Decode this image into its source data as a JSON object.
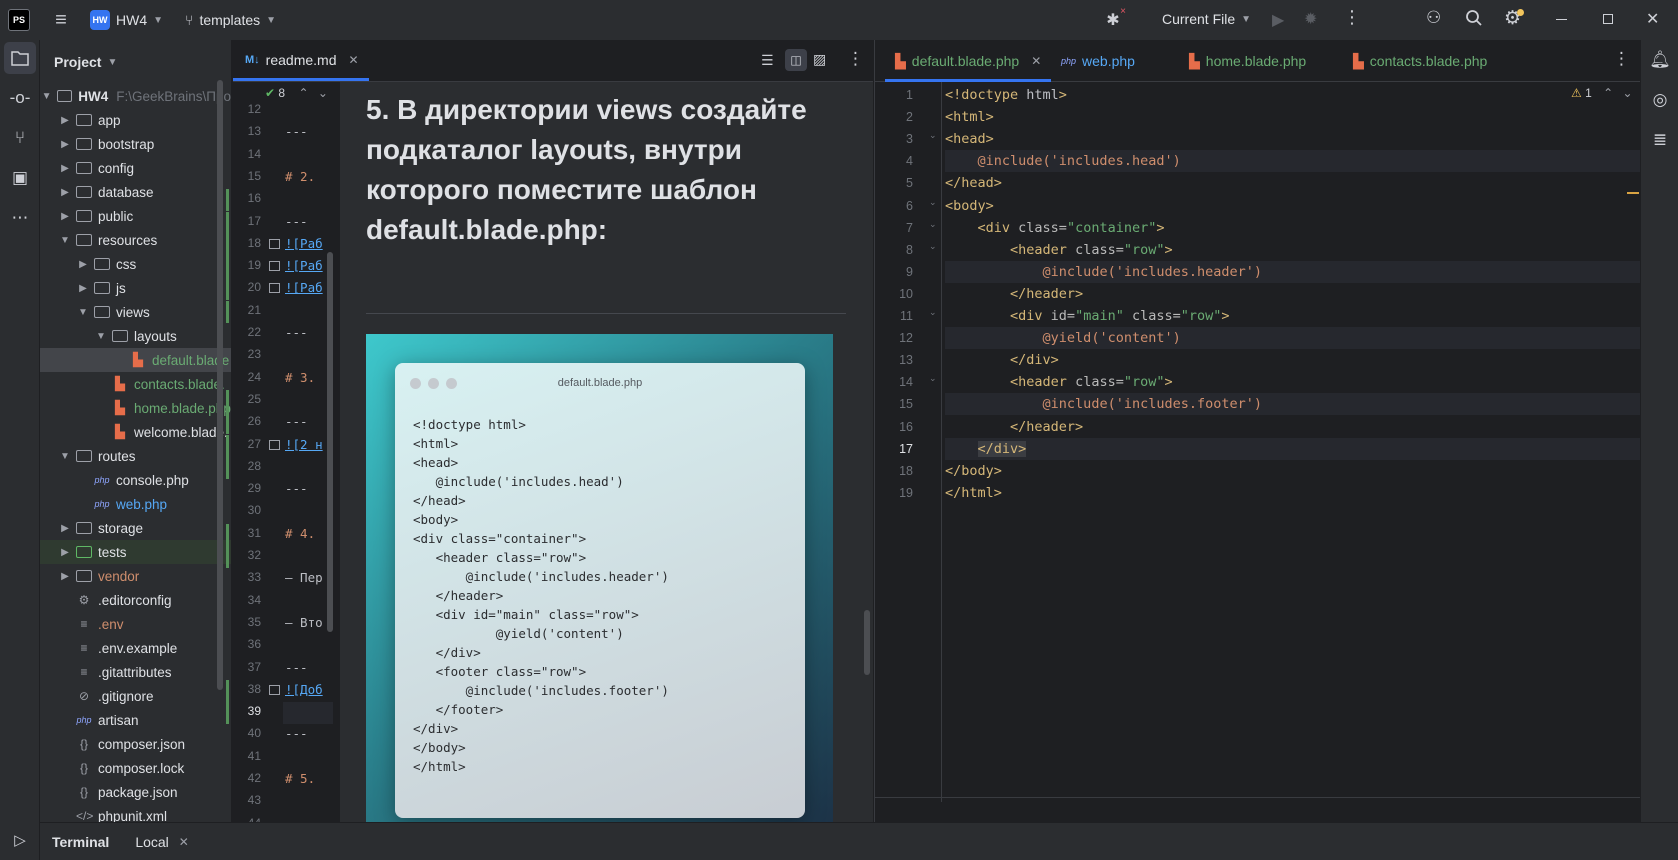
{
  "titlebar": {
    "app_logo": "PS",
    "project_badge": "HW",
    "project_name": "HW4",
    "branch": "templates",
    "run_config": "Current File"
  },
  "project_panel": {
    "title": "Project",
    "root_name": "HW4",
    "root_path": "F:\\GeekBrains\\Про",
    "tree": [
      {
        "label": "app",
        "type": "folder",
        "depth": 1,
        "open": false
      },
      {
        "label": "bootstrap",
        "type": "folder",
        "depth": 1,
        "open": false
      },
      {
        "label": "config",
        "type": "folder",
        "depth": 1,
        "open": false
      },
      {
        "label": "database",
        "type": "folder",
        "depth": 1,
        "open": false
      },
      {
        "label": "public",
        "type": "folder",
        "depth": 1,
        "open": false
      },
      {
        "label": "resources",
        "type": "folder",
        "depth": 1,
        "open": true
      },
      {
        "label": "css",
        "type": "folder",
        "depth": 2,
        "open": false
      },
      {
        "label": "js",
        "type": "folder",
        "depth": 2,
        "open": false
      },
      {
        "label": "views",
        "type": "folder",
        "depth": 2,
        "open": true
      },
      {
        "label": "layouts",
        "type": "folder",
        "depth": 3,
        "open": true
      },
      {
        "label": "default.blade",
        "type": "blade",
        "depth": 4,
        "selected": true,
        "color": "#6aab73"
      },
      {
        "label": "contacts.blade.",
        "type": "blade",
        "depth": 3,
        "color": "#6aab73"
      },
      {
        "label": "home.blade.php",
        "type": "blade",
        "depth": 3,
        "color": "#6aab73"
      },
      {
        "label": "welcome.blade.",
        "type": "blade",
        "depth": 3,
        "color": "#dfe1e5"
      },
      {
        "label": "routes",
        "type": "folder",
        "depth": 1,
        "open": true
      },
      {
        "label": "console.php",
        "type": "php",
        "depth": 2,
        "color": "#dfe1e5"
      },
      {
        "label": "web.php",
        "type": "php",
        "depth": 2,
        "color": "#56a8f5"
      },
      {
        "label": "storage",
        "type": "folder",
        "depth": 1,
        "open": false
      },
      {
        "label": "tests",
        "type": "folder",
        "depth": 1,
        "open": false,
        "color": "#dfe1e5"
      },
      {
        "label": "vendor",
        "type": "folder",
        "depth": 1,
        "open": false,
        "color": "#cf8e6d"
      },
      {
        "label": ".editorconfig",
        "type": "gear",
        "depth": 1
      },
      {
        "label": ".env",
        "type": "lines",
        "depth": 1,
        "color": "#cf8e6d"
      },
      {
        "label": ".env.example",
        "type": "lines",
        "depth": 1
      },
      {
        "label": ".gitattributes",
        "type": "lines",
        "depth": 1
      },
      {
        "label": ".gitignore",
        "type": "ban",
        "depth": 1
      },
      {
        "label": "artisan",
        "type": "php",
        "depth": 1
      },
      {
        "label": "composer.json",
        "type": "braces",
        "depth": 1
      },
      {
        "label": "composer.lock",
        "type": "braces",
        "depth": 1
      },
      {
        "label": "package.json",
        "type": "braces",
        "depth": 1
      },
      {
        "label": "phpunit.xml",
        "type": "xml",
        "depth": 1
      }
    ]
  },
  "md_editor": {
    "tab_label": "readme.md",
    "tab_icon": "M↓",
    "inspection_count": "8",
    "line_numbers": [
      "12",
      "13",
      "14",
      "15",
      "16",
      "17",
      "18",
      "19",
      "20",
      "21",
      "22",
      "23",
      "24",
      "25",
      "26",
      "27",
      "28",
      "29",
      "30",
      "31",
      "32",
      "33",
      "34",
      "35",
      "36",
      "37",
      "38",
      "39",
      "40",
      "41",
      "42",
      "43",
      "44"
    ],
    "source_fragments": [
      {
        "line": "13",
        "text": "---"
      },
      {
        "line": "15",
        "text": "# 2."
      },
      {
        "line": "17",
        "text": "---"
      },
      {
        "line": "18",
        "text": "![Раб"
      },
      {
        "line": "19",
        "text": "![Раб"
      },
      {
        "line": "20",
        "text": "![Раб"
      },
      {
        "line": "22",
        "text": "---"
      },
      {
        "line": "24",
        "text": "# 3."
      },
      {
        "line": "26",
        "text": "---"
      },
      {
        "line": "27",
        "text": "![2 н"
      },
      {
        "line": "29",
        "text": "---"
      },
      {
        "line": "31",
        "text": "# 4."
      },
      {
        "line": "33",
        "text": "— Пер"
      },
      {
        "line": "35",
        "text": "— Вто"
      },
      {
        "line": "37",
        "text": "---"
      },
      {
        "line": "38",
        "text": "![Доб"
      },
      {
        "line": "40",
        "text": "---"
      },
      {
        "line": "42",
        "text": "# 5."
      },
      {
        "line": "44",
        "text": "---"
      }
    ],
    "preview_heading": "5. В директории views создайте подкаталог layouts, внутри которого поместите шаблон default.blade.php:",
    "card_title": "default.blade.php",
    "card_code": [
      "<!doctype html>",
      "<html>",
      "<head>",
      "   @include('includes.head')",
      "</head>",
      "<body>",
      "<div class=\"container\">",
      "   <header class=\"row\">",
      "       @include('includes.header')",
      "   </header>",
      "   <div id=\"main\" class=\"row\">",
      "           @yield('content')",
      "   </div>",
      "   <footer class=\"row\">",
      "       @include('includes.footer')",
      "   </footer>",
      "</div>",
      "</body>",
      "</html>"
    ]
  },
  "php_editor": {
    "tabs": [
      "default.blade.php",
      "web.php",
      "home.blade.php",
      "contacts.blade.php"
    ],
    "warning_count": "1",
    "line_numbers": [
      "1",
      "2",
      "3",
      "4",
      "5",
      "6",
      "7",
      "8",
      "9",
      "10",
      "11",
      "12",
      "13",
      "14",
      "15",
      "16",
      "17",
      "18",
      "19"
    ],
    "lines": [
      [
        {
          "c": "tag",
          "t": "<!doctype "
        },
        {
          "c": "plain",
          "t": "html"
        },
        {
          "c": "tag",
          "t": ">"
        }
      ],
      [
        {
          "c": "tag",
          "t": "<html>"
        }
      ],
      [
        {
          "c": "tag",
          "t": "<head>"
        }
      ],
      [
        {
          "c": "plain",
          "t": "    "
        },
        {
          "c": "blade",
          "t": "@include('includes.head')"
        }
      ],
      [
        {
          "c": "tag",
          "t": "</head>"
        }
      ],
      [
        {
          "c": "tag",
          "t": "<body>"
        }
      ],
      [
        {
          "c": "plain",
          "t": "    "
        },
        {
          "c": "tag",
          "t": "<div "
        },
        {
          "c": "attr",
          "t": "class="
        },
        {
          "c": "str",
          "t": "\"container\""
        },
        {
          "c": "tag",
          "t": ">"
        }
      ],
      [
        {
          "c": "plain",
          "t": "        "
        },
        {
          "c": "tag",
          "t": "<header "
        },
        {
          "c": "attr",
          "t": "class="
        },
        {
          "c": "str",
          "t": "\"row\""
        },
        {
          "c": "tag",
          "t": ">"
        }
      ],
      [
        {
          "c": "plain",
          "t": "            "
        },
        {
          "c": "blade",
          "t": "@include('includes.header')"
        }
      ],
      [
        {
          "c": "plain",
          "t": "        "
        },
        {
          "c": "tag",
          "t": "</header>"
        }
      ],
      [
        {
          "c": "plain",
          "t": "        "
        },
        {
          "c": "tag",
          "t": "<div "
        },
        {
          "c": "attr",
          "t": "id="
        },
        {
          "c": "str",
          "t": "\"main\" "
        },
        {
          "c": "attr",
          "t": "class="
        },
        {
          "c": "str",
          "t": "\"row\""
        },
        {
          "c": "tag",
          "t": ">"
        }
      ],
      [
        {
          "c": "plain",
          "t": "            "
        },
        {
          "c": "blade",
          "t": "@yield('content')"
        }
      ],
      [
        {
          "c": "plain",
          "t": "        "
        },
        {
          "c": "tag",
          "t": "</div>"
        }
      ],
      [
        {
          "c": "plain",
          "t": "        "
        },
        {
          "c": "tag",
          "t": "<header "
        },
        {
          "c": "attr",
          "t": "class="
        },
        {
          "c": "str",
          "t": "\"row\""
        },
        {
          "c": "tag",
          "t": ">"
        }
      ],
      [
        {
          "c": "plain",
          "t": "            "
        },
        {
          "c": "blade",
          "t": "@include('includes.footer')"
        }
      ],
      [
        {
          "c": "plain",
          "t": "        "
        },
        {
          "c": "tag",
          "t": "</header>"
        }
      ],
      [
        {
          "c": "plain",
          "t": "    "
        },
        {
          "c": "tag",
          "t": "</div>"
        }
      ],
      [
        {
          "c": "tag",
          "t": "</body>"
        }
      ],
      [
        {
          "c": "tag",
          "t": "</html>"
        }
      ]
    ]
  },
  "bottom_panel": {
    "terminal_label": "Terminal",
    "local_tab": "Local"
  },
  "colors": {
    "accent": "#3574f0",
    "tag": "#d5b778",
    "string": "#6aab73",
    "blade": "#cf8e6d"
  }
}
